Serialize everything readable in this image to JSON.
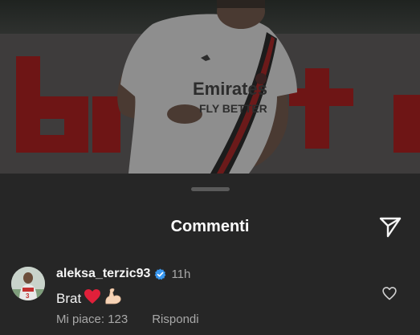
{
  "photo": {
    "description_icon": "football-player-photo",
    "jersey_sponsor_line1": "Emirates",
    "jersey_sponsor_line2": "FLY BETTER"
  },
  "sheet": {
    "title": "Commenti",
    "share_icon": "send-paper-plane-icon"
  },
  "comment": {
    "username": "aleksa_terzic93",
    "verified_icon": "verified-badge-icon",
    "time": "11h",
    "text": "Brat",
    "emoji_heart": "❤️",
    "emoji_muscle": "💪🏻",
    "likes_label": "Mi piace: 123",
    "reply_label": "Rispondi",
    "like_icon": "heart-outline-icon"
  },
  "colors": {
    "sheet_bg": "#262626",
    "text_primary": "#f5f5f5",
    "text_secondary": "#a8a8a8",
    "verified_blue": "#3897f0",
    "banner_red": "#7a1414"
  }
}
